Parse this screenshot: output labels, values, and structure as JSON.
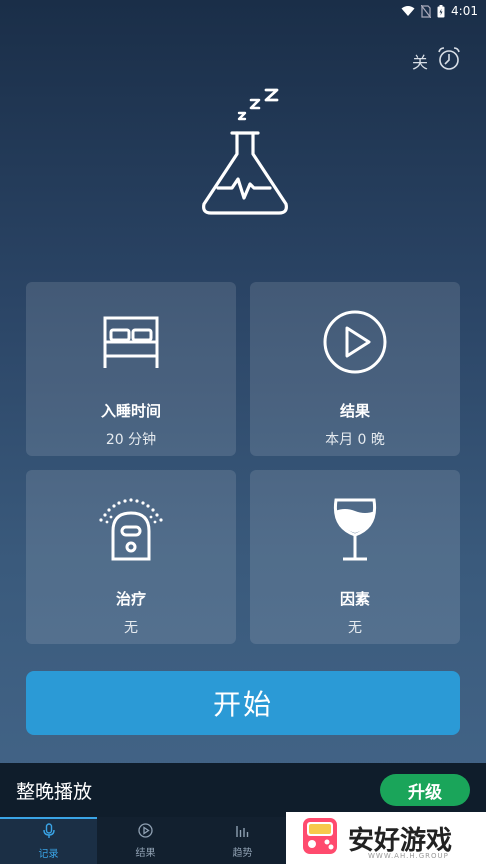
{
  "status_bar": {
    "time": "4:01",
    "icons": [
      "wifi-icon",
      "no-sim-icon",
      "battery-icon"
    ]
  },
  "alarm": {
    "label": "关",
    "icon": "alarm-clock-icon"
  },
  "hero": {
    "icon": "sleeping-flask-icon",
    "zzz": "z z Z"
  },
  "cards": [
    {
      "icon": "bed-icon",
      "title": "入睡时间",
      "subtitle": "20 分钟"
    },
    {
      "icon": "play-circle-icon",
      "title": "结果",
      "subtitle": "本月 0 晚"
    },
    {
      "icon": "humidifier-icon",
      "title": "治疗",
      "subtitle": "无"
    },
    {
      "icon": "wine-glass-icon",
      "title": "因素",
      "subtitle": "无"
    }
  ],
  "start_button": {
    "label": "开始"
  },
  "playbar": {
    "label": "整晚播放",
    "upgrade_label": "升级"
  },
  "nav": {
    "items": [
      {
        "label": "记录",
        "icon": "mic-icon",
        "active": true
      },
      {
        "label": "结果",
        "icon": "play-circle-icon",
        "active": false
      },
      {
        "label": "趋势",
        "icon": "bar-chart-icon",
        "active": false
      }
    ]
  },
  "watermark": {
    "text": "安好游戏",
    "sub": "WWW.AH.H.GROUP",
    "icon": "game-console-logo-icon"
  },
  "colors": {
    "accent": "#2b9ad6",
    "upgrade": "#1aa55a",
    "nav_active": "#3aa4e6"
  }
}
